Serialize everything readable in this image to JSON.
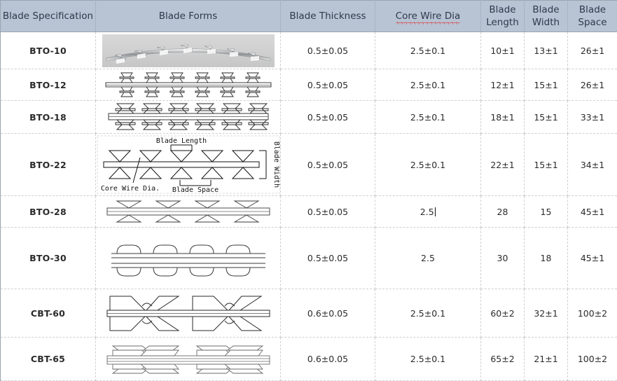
{
  "table": {
    "headers": [
      {
        "id": "blade-specification",
        "label": "Blade Specification",
        "lines": [
          "Blade Specification"
        ]
      },
      {
        "id": "blade-forms",
        "label": "Blade Forms",
        "lines": [
          "Blade Forms"
        ]
      },
      {
        "id": "blade-thickness",
        "label": "Blade Thickness",
        "lines": [
          "Blade Thickness"
        ]
      },
      {
        "id": "core-wire-dia",
        "label": "Core Wire Dia",
        "lines": [
          "Core Wire Dia"
        ],
        "misspelled_word": "Dia",
        "spellcheck_underline": true
      },
      {
        "id": "blade-length",
        "label": "Blade Length",
        "lines": [
          "Blade",
          "Length"
        ]
      },
      {
        "id": "blade-width",
        "label": "Blade Width",
        "lines": [
          "Blade",
          "Width"
        ]
      },
      {
        "id": "blade-space",
        "label": "Blade Space",
        "lines": [
          "Blade",
          "Space"
        ]
      }
    ],
    "header_bg": "#b8c3d4",
    "header_text_color": "#2d3a4a",
    "grid_color": "#cfcfcf",
    "rows": [
      {
        "spec": "BTO-10",
        "form_type": "photo",
        "thickness": "0.5±0.05",
        "core_wire_dia": "2.5±0.1",
        "blade_length": "10±1",
        "blade_width": "13±1",
        "blade_space": "26±1"
      },
      {
        "spec": "BTO-12",
        "form_type": "short-barb",
        "thickness": "0.5±0.05",
        "core_wire_dia": "2.5±0.1",
        "blade_length": "12±1",
        "blade_width": "15±1",
        "blade_space": "26±1"
      },
      {
        "spec": "BTO-18",
        "form_type": "medium-barb",
        "thickness": "0.5±0.05",
        "core_wire_dia": "2.5±0.1",
        "blade_length": "18±1",
        "blade_width": "15±1",
        "blade_space": "33±1"
      },
      {
        "spec": "BTO-22",
        "form_type": "annotated",
        "annotations": {
          "blade_length": "Blade Length",
          "blade_width": "Blade Width",
          "core_wire_dia": "Core Wire Dia.",
          "blade_space": "Blade Space"
        },
        "thickness": "0.5±0.05",
        "core_wire_dia": "2.5±0.1",
        "blade_length": "22±1",
        "blade_width": "15±1",
        "blade_space": "34±1"
      },
      {
        "spec": "BTO-28",
        "form_type": "long-barb",
        "thickness": "0.5±0.05",
        "core_wire_dia": "2.5",
        "core_wire_dia_caret": true,
        "blade_length": "28",
        "blade_width": "15",
        "blade_space": "45±1"
      },
      {
        "spec": "BTO-30",
        "form_type": "double-strand",
        "thickness": "0.5±0.05",
        "core_wire_dia": "2.5",
        "blade_length": "30",
        "blade_width": "18",
        "blade_space": "45±1"
      },
      {
        "spec": "CBT-60",
        "form_type": "cross-barb",
        "thickness": "0.6±0.05",
        "core_wire_dia": "2.5±0.1",
        "blade_length": "60±2",
        "blade_width": "32±1",
        "blade_space": "100±2"
      },
      {
        "spec": "CBT-65",
        "form_type": "flat-cross-barb",
        "thickness": "0.6±0.05",
        "core_wire_dia": "2.5±0.1",
        "blade_length": "65±2",
        "blade_width": "21±1",
        "blade_space": "100±2"
      }
    ]
  }
}
